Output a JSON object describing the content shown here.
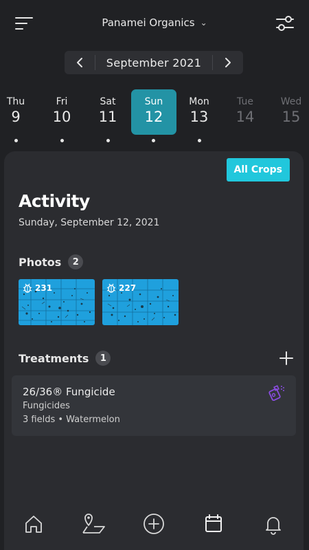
{
  "header": {
    "org_name": "Panamei Organics",
    "menu_icon": "hamburger-menu-icon",
    "org_dropdown_icon": "chevron-down-icon",
    "filter_icon": "sliders-icon"
  },
  "calendar": {
    "month_label": "September 2021",
    "prev_icon": "chevron-left-icon",
    "next_icon": "chevron-right-icon",
    "days": [
      {
        "name": "Thu",
        "num": "9",
        "state": "normal",
        "dot": true
      },
      {
        "name": "Fri",
        "num": "10",
        "state": "normal",
        "dot": true
      },
      {
        "name": "Sat",
        "num": "11",
        "state": "normal",
        "dot": true
      },
      {
        "name": "Sun",
        "num": "12",
        "state": "selected",
        "dot": true
      },
      {
        "name": "Mon",
        "num": "13",
        "state": "normal",
        "dot": true
      },
      {
        "name": "Tue",
        "num": "14",
        "state": "dim",
        "dot": false
      },
      {
        "name": "Wed",
        "num": "15",
        "state": "dim",
        "dot": false
      }
    ],
    "selected_color": "#2393a5"
  },
  "panel": {
    "filter_button": "All Crops",
    "filter_color": "#21c7dc",
    "title": "Activity",
    "date": "Sunday, September 12, 2021"
  },
  "photos": {
    "label": "Photos",
    "count": "2",
    "items": [
      {
        "count": "231",
        "icon": "bug-icon"
      },
      {
        "count": "227",
        "icon": "bug-icon"
      }
    ]
  },
  "treatments": {
    "label": "Treatments",
    "count": "1",
    "add_icon": "plus-icon",
    "items": [
      {
        "name": "26/36® Fungicide",
        "category": "Fungicides",
        "detail": "3 fields • Watermelon",
        "icon": "spray-icon",
        "icon_color": "#8a4de0"
      }
    ]
  },
  "bottom_nav": [
    {
      "icon": "home-icon"
    },
    {
      "icon": "map-pin-field-icon"
    },
    {
      "icon": "plus-circle-icon"
    },
    {
      "icon": "calendar-icon",
      "active": true
    },
    {
      "icon": "bell-icon"
    }
  ]
}
